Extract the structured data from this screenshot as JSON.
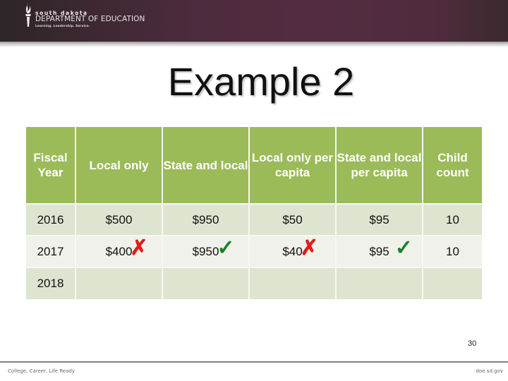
{
  "header": {
    "logo": {
      "icon": "torch-icon",
      "line1": "south dakota",
      "line2": "DEPARTMENT OF EDUCATION",
      "tagline": "Learning. Leadership. Service."
    }
  },
  "slide": {
    "title": "Example 2",
    "page_number": "30"
  },
  "table": {
    "headers": [
      "Fiscal Year",
      "Local only",
      "State and local",
      "Local only per capita",
      "State and local per capita",
      "Child count"
    ],
    "rows": [
      {
        "fiscal_year": "2016",
        "local_only": "$500",
        "state_and_local": "$950",
        "local_only_per_capita": "$50",
        "state_and_local_per_capita": "$95",
        "child_count": "10"
      },
      {
        "fiscal_year": "2017",
        "local_only": "$400",
        "local_only_mark": "✗",
        "state_and_local": "$950",
        "state_and_local_mark": "✓",
        "local_only_per_capita": "$40",
        "local_only_per_capita_mark": "✗",
        "state_and_local_per_capita": "$95",
        "state_and_local_per_capita_mark": "✓",
        "child_count": "10"
      },
      {
        "fiscal_year": "2018",
        "local_only": "",
        "state_and_local": "",
        "local_only_per_capita": "",
        "state_and_local_per_capita": "",
        "child_count": ""
      }
    ],
    "colors": {
      "header_bg": "#9bbb59",
      "row_odd_bg": "#dde4d0",
      "row_even_bg": "#eff1ea",
      "fail_mark": "#e11b1b",
      "pass_mark": "#1d7f24"
    }
  },
  "footer": {
    "left_text": "College, Career, Life Ready",
    "right_text": "doe.sd.gov"
  }
}
